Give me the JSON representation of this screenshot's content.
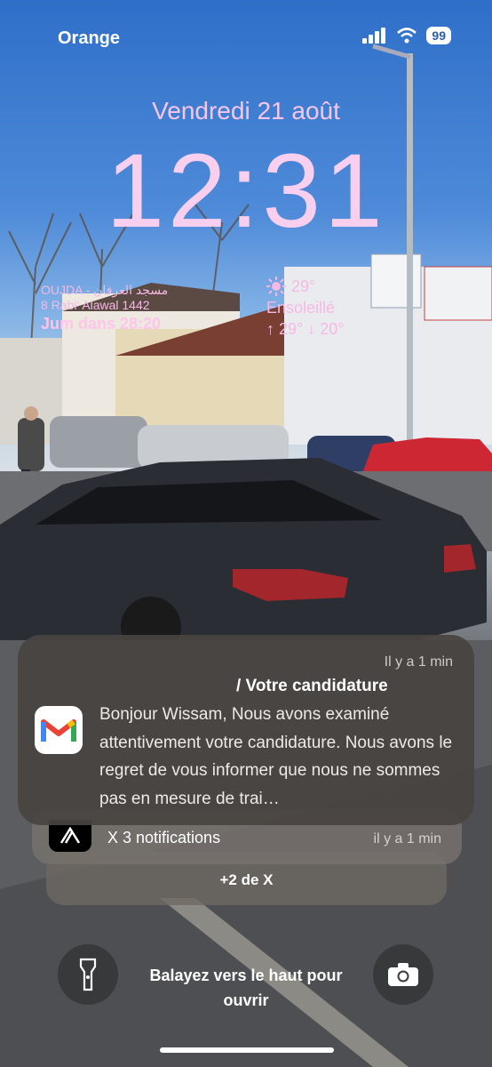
{
  "status_bar": {
    "carrier": "Orange",
    "battery": "99"
  },
  "lock": {
    "date": "Vendredi 21 août",
    "time": "12:31"
  },
  "widget_prayer": {
    "line1": "OUJDA - مسجد العرفان",
    "line2": "8 Rabi' Alawal 1442",
    "next": "Jum dans 28:20"
  },
  "widget_weather": {
    "temp": "29°",
    "condition": "Ensoleillé",
    "range": "↑ 29° ↓ 20°"
  },
  "notification": {
    "time_ago": "Il y a 1 min",
    "title": "/ Votre candidature",
    "body": "Bonjour Wissam, Nous avons examiné attentivement votre candidature. Nous avons le regret de vous informer que nous ne sommes pas en mesure de trai…",
    "app_icon": "gmail-icon"
  },
  "grouped": {
    "label": "X  3 notifications",
    "time_ago": "il y a 1 min",
    "app_icon": "x-icon"
  },
  "more": "+2 de X",
  "bottom": {
    "swipe_text": "Balayez vers le haut pour ouvrir"
  },
  "colors": {
    "time": "#f8cfee",
    "widget": "#f6b9e4"
  }
}
